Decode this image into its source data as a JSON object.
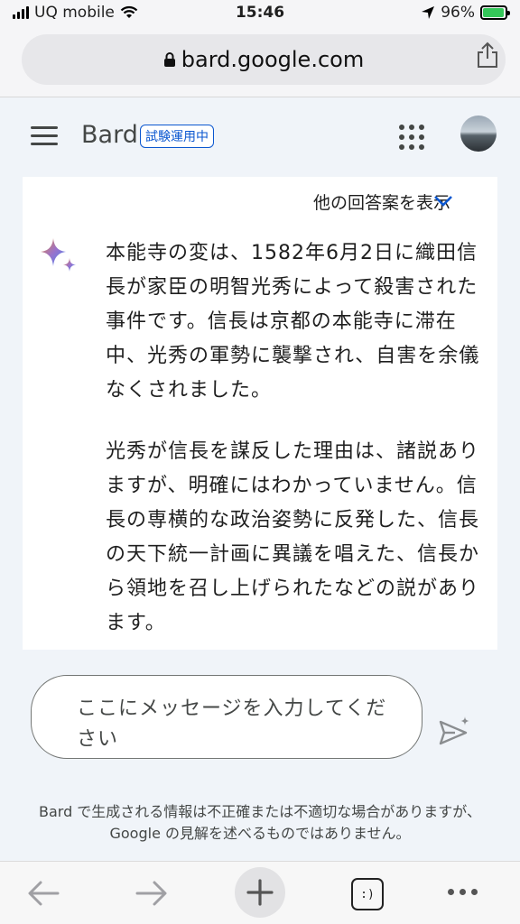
{
  "status_bar": {
    "carrier": "UQ mobile",
    "time": "15:46",
    "battery_percent": "96%",
    "battery_level": 0.96
  },
  "browser": {
    "url": "bard.google.com"
  },
  "header": {
    "brand": "Bard",
    "badge": "試験運用中"
  },
  "response": {
    "drafts_label": "他の回答案を表示",
    "paragraphs": [
      "本能寺の変は、1582年6月2日に織田信長が家臣の明智光秀によって殺害された事件です。信長は京都の本能寺に滞在中、光秀の軍勢に襲撃され、自害を余儀なくされました。",
      "光秀が信長を謀反した理由は、諸説ありますが、明確にはわかっていません。信長の専横的な政治姿勢に反発した、信長の天下統一計画に異議を唱えた、信長から領地を召し上げられたなどの説があります。"
    ]
  },
  "input": {
    "placeholder": "ここにメッセージを入力してください"
  },
  "disclaimer": "Bard で生成される情報は不正確または不適切な場合がありますが、Google の見解を述べるものではありません。",
  "toolbar": {
    "tabs_label": ":)"
  }
}
